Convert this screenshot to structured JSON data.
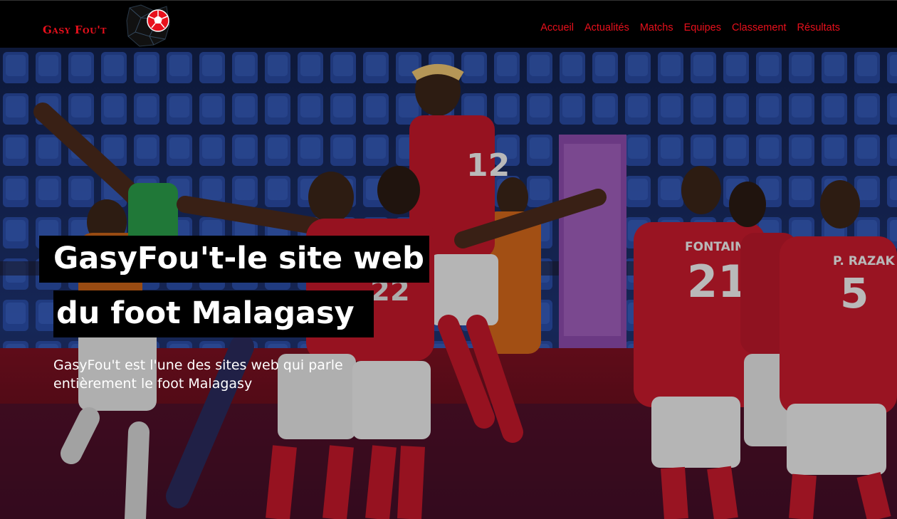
{
  "header": {
    "logo_text": "Gasy Fou't",
    "nav": [
      {
        "label": "Accueil"
      },
      {
        "label": "Actualités"
      },
      {
        "label": "Matchs"
      },
      {
        "label": "Equipes"
      },
      {
        "label": "Classement"
      },
      {
        "label": "Résultats"
      }
    ]
  },
  "hero": {
    "title_line1": "GasyFou't-le site web",
    "title_line2": "du foot Malagasy",
    "subtitle": "GasyFou't est l'une des sites web qui parle entièrement le foot Malagasy",
    "jersey_numbers": [
      "12",
      "22",
      "21",
      "5"
    ],
    "jersey_names": [
      "FONTAINE",
      "P. RAZAK"
    ]
  },
  "colors": {
    "brand_red": "#e8101c",
    "nav_bg": "#000000",
    "title_bg": "#000000"
  },
  "icons": [
    "soccer-ball-icon"
  ]
}
